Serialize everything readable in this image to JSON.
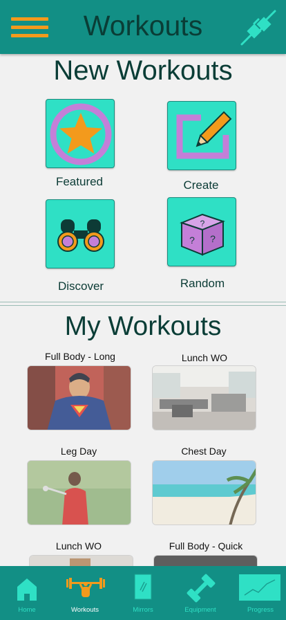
{
  "header": {
    "title": "Workouts",
    "menu_icon": "hamburger-menu-icon",
    "connect_icon": "plug-connection-icon"
  },
  "new_workouts": {
    "title": "New Workouts",
    "tiles": [
      {
        "label": "Featured",
        "icon": "star-icon"
      },
      {
        "label": "Create",
        "icon": "pencil-edit-icon"
      },
      {
        "label": "Discover",
        "icon": "binoculars-icon"
      },
      {
        "label": "Random",
        "icon": "dice-icon"
      }
    ]
  },
  "my_workouts": {
    "title": "My Workouts",
    "items": [
      {
        "label": "Full Body - Long",
        "image": "superhero-comic"
      },
      {
        "label": "Lunch WO",
        "image": "office-gym"
      },
      {
        "label": "Leg Day",
        "image": "golfer-swing"
      },
      {
        "label": "Chest Day",
        "image": "tropical-beach"
      },
      {
        "label": "Lunch WO",
        "image": "partial-image"
      },
      {
        "label": "Full Body - Quick",
        "image": "partial-image"
      }
    ]
  },
  "tabbar": {
    "tabs": [
      {
        "label": "Home",
        "icon": "home-icon",
        "active": false
      },
      {
        "label": "Workouts",
        "icon": "weightlifter-icon",
        "active": true
      },
      {
        "label": "Mirrors",
        "icon": "mirror-icon",
        "active": false
      },
      {
        "label": "Equipment",
        "icon": "dumbbell-icon",
        "active": false
      },
      {
        "label": "Progress",
        "icon": "chart-icon",
        "active": false
      }
    ]
  },
  "colors": {
    "header_bg": "#128f85",
    "tile_bg": "#2fe0c5",
    "accent_orange": "#f39a1c",
    "accent_purple": "#c47fd8",
    "title_text": "#0a3d36"
  }
}
